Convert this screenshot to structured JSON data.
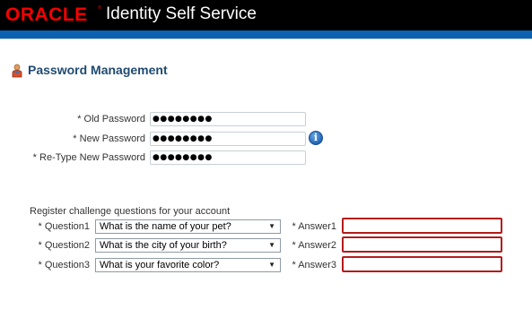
{
  "header": {
    "logo_text": "ORACLE",
    "logo_reg": "®",
    "app_title": "Identity Self Service"
  },
  "section": {
    "title": "Password Management",
    "icon": "person-icon"
  },
  "password_form": {
    "old_password": {
      "label": "* Old Password",
      "value": "●●●●●●●●"
    },
    "new_password": {
      "label": "* New Password",
      "value": "●●●●●●●●"
    },
    "retype_password": {
      "label": "* Re-Type New Password",
      "value": "●●●●●●●●"
    },
    "info_icon": "i"
  },
  "challenge": {
    "intro": "Register challenge questions for your account",
    "rows": [
      {
        "question_label": "* Question1",
        "question_value": "What is the name of your pet?",
        "answer_label": "* Answer1",
        "answer_value": ""
      },
      {
        "question_label": "* Question2",
        "question_value": "What is the city of your birth?",
        "answer_label": "* Answer2",
        "answer_value": ""
      },
      {
        "question_label": "* Question3",
        "question_value": "What is your favorite color?",
        "answer_label": "* Answer3",
        "answer_value": ""
      }
    ],
    "dropdown_glyph": "▼"
  },
  "colors": {
    "oracle_red": "#f80000",
    "header_bg": "#000000",
    "brand_blue": "#0b62b0",
    "error_border": "#b31b1b",
    "heading": "#1f4a70"
  }
}
